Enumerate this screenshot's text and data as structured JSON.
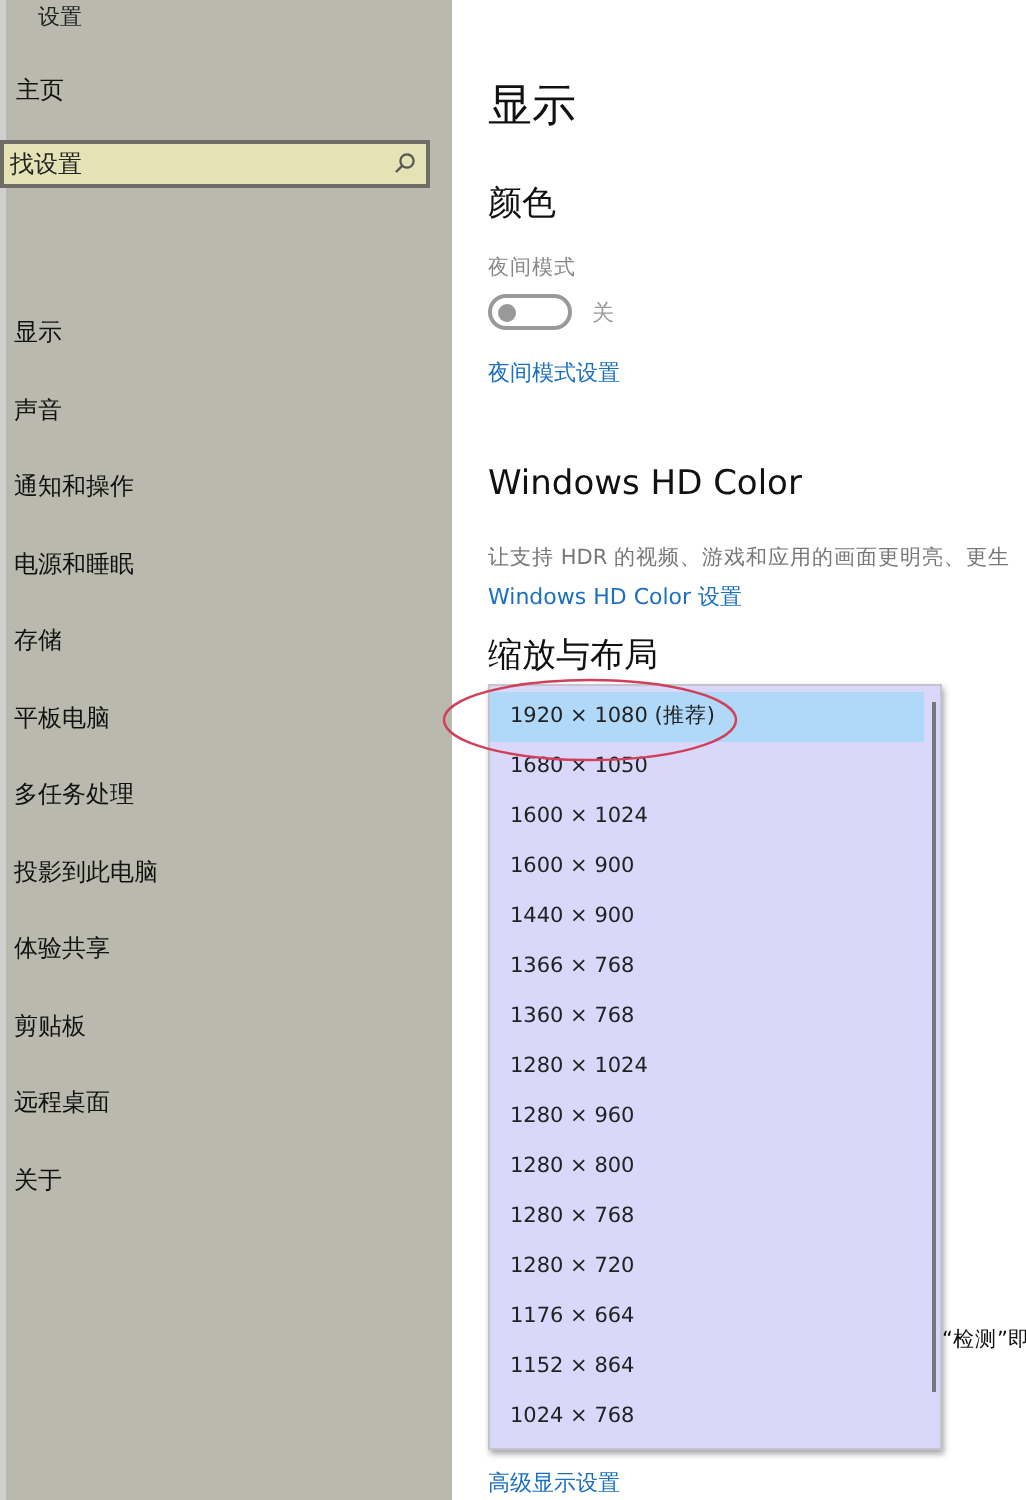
{
  "window": {
    "title": "设置"
  },
  "sidebar": {
    "home": "主页",
    "search": {
      "placeholder": "找设置"
    },
    "items": [
      {
        "label": "显示",
        "selected": false
      },
      {
        "label": "声音",
        "selected": false
      },
      {
        "label": "通知和操作",
        "selected": false
      },
      {
        "label": "电源和睡眠",
        "selected": false
      },
      {
        "label": "存储",
        "selected": false
      },
      {
        "label": "平板电脑",
        "selected": false
      },
      {
        "label": "多任务处理",
        "selected": false
      },
      {
        "label": "投影到此电脑",
        "selected": false
      },
      {
        "label": "体验共享",
        "selected": false
      },
      {
        "label": "剪贴板",
        "selected": false
      },
      {
        "label": "远程桌面",
        "selected": false
      },
      {
        "label": "关于",
        "selected": false
      }
    ]
  },
  "main": {
    "title": "显示",
    "color_section": {
      "heading": "颜色",
      "night_light": {
        "label": "夜间模式",
        "on": false,
        "state_text": "关"
      },
      "link": "夜间模式设置"
    },
    "hd_section": {
      "heading": "Windows HD Color",
      "description": "让支持 HDR 的视频、游戏和应用的画面更明亮、更生",
      "link": "Windows HD Color 设置"
    },
    "scale_section": {
      "heading": "缩放与布局"
    },
    "detect_text": "“检测”即",
    "advanced_link": "高级显示设置"
  },
  "resolution_dropdown": {
    "options": [
      {
        "label": "1920 × 1080 (推荐)",
        "selected": true
      },
      {
        "label": "1680 × 1050",
        "selected": false
      },
      {
        "label": "1600 × 1024",
        "selected": false
      },
      {
        "label": "1600 × 900",
        "selected": false
      },
      {
        "label": "1440 × 900",
        "selected": false
      },
      {
        "label": "1366 × 768",
        "selected": false
      },
      {
        "label": "1360 × 768",
        "selected": false
      },
      {
        "label": "1280 × 1024",
        "selected": false
      },
      {
        "label": "1280 × 960",
        "selected": false
      },
      {
        "label": "1280 × 800",
        "selected": false
      },
      {
        "label": "1280 × 768",
        "selected": false
      },
      {
        "label": "1280 × 720",
        "selected": false
      },
      {
        "label": "1176 × 664",
        "selected": false
      },
      {
        "label": "1152 × 864",
        "selected": false
      },
      {
        "label": "1024 × 768",
        "selected": false
      }
    ]
  }
}
